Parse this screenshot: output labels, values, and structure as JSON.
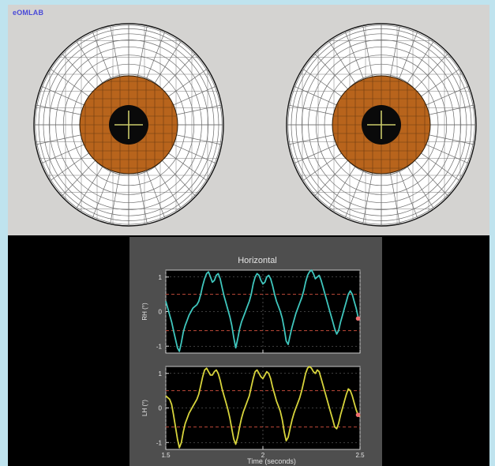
{
  "app": {
    "title": "eOMLAB"
  },
  "eyes": {
    "left": {
      "iris_color": "#b8641c",
      "pupil_color": "#0a0a0a",
      "crosshair_color": "#c9c96a"
    },
    "right": {
      "iris_color": "#b8641c",
      "pupil_color": "#0a0a0a",
      "crosshair_color": "#c9c96a"
    },
    "sclera_color": "#ffffff",
    "grid_color": "#6a6a6a"
  },
  "plot": {
    "title": "Horizontal",
    "xlabel": "Time (seconds)",
    "background": "#4e4e4e",
    "axes_background": "#000000"
  },
  "chart_data": [
    {
      "type": "line",
      "title": "",
      "ylabel": "RH (°)",
      "xlim": [
        1.5,
        2.5
      ],
      "ylim": [
        -1.2,
        1.2
      ],
      "xticks": [
        1.5,
        2.0,
        2.5
      ],
      "xtick_labels": [
        "1.5",
        "2",
        "2.5"
      ],
      "yticks": [
        -1,
        0,
        1
      ],
      "ytick_labels": [
        "-1",
        "0",
        "1"
      ],
      "dashed_reference_y": [
        -0.55,
        0.5
      ],
      "grid": true,
      "series": [
        {
          "color": "#3fc6bd",
          "x": [
            1.5,
            1.51,
            1.52,
            1.53,
            1.54,
            1.55,
            1.56,
            1.57,
            1.58,
            1.59,
            1.6,
            1.61,
            1.62,
            1.63,
            1.64,
            1.65,
            1.66,
            1.67,
            1.68,
            1.69,
            1.7,
            1.71,
            1.72,
            1.73,
            1.74,
            1.75,
            1.76,
            1.77,
            1.78,
            1.79,
            1.8,
            1.81,
            1.82,
            1.83,
            1.84,
            1.85,
            1.86,
            1.87,
            1.88,
            1.89,
            1.9,
            1.91,
            1.92,
            1.93,
            1.94,
            1.95,
            1.96,
            1.97,
            1.98,
            1.99,
            2.0,
            2.01,
            2.02,
            2.03,
            2.04,
            2.05,
            2.06,
            2.07,
            2.08,
            2.09,
            2.1,
            2.11,
            2.12,
            2.13,
            2.14,
            2.15,
            2.16,
            2.17,
            2.18,
            2.19,
            2.2,
            2.21,
            2.22,
            2.23,
            2.24,
            2.25,
            2.26,
            2.27,
            2.28,
            2.29,
            2.3,
            2.31,
            2.32,
            2.33,
            2.34,
            2.35,
            2.36,
            2.37,
            2.38,
            2.39,
            2.4,
            2.41,
            2.42,
            2.43,
            2.44,
            2.45,
            2.46,
            2.47,
            2.48,
            2.49,
            2.5
          ],
          "y": [
            0.3,
            0.1,
            -0.1,
            -0.3,
            -0.55,
            -0.8,
            -1.05,
            -1.15,
            -0.9,
            -0.6,
            -0.4,
            -0.25,
            -0.1,
            0.0,
            0.1,
            0.15,
            0.2,
            0.3,
            0.5,
            0.75,
            0.95,
            1.1,
            1.15,
            1.0,
            0.85,
            0.9,
            1.05,
            1.1,
            0.95,
            0.7,
            0.45,
            0.25,
            0.05,
            -0.15,
            -0.4,
            -0.75,
            -1.05,
            -0.8,
            -0.5,
            -0.3,
            -0.15,
            0.0,
            0.15,
            0.3,
            0.5,
            0.8,
            1.0,
            1.1,
            1.05,
            0.9,
            0.8,
            0.85,
            1.0,
            1.05,
            0.95,
            0.75,
            0.5,
            0.3,
            0.15,
            0.0,
            -0.2,
            -0.5,
            -0.85,
            -0.95,
            -0.7,
            -0.45,
            -0.25,
            -0.05,
            0.1,
            0.25,
            0.4,
            0.6,
            0.85,
            1.05,
            1.15,
            1.2,
            1.1,
            0.95,
            1.0,
            1.05,
            0.9,
            0.7,
            0.5,
            0.3,
            0.1,
            -0.1,
            -0.3,
            -0.5,
            -0.65,
            -0.55,
            -0.3,
            -0.1,
            0.1,
            0.3,
            0.5,
            0.6,
            0.5,
            0.3,
            0.1,
            -0.15,
            -0.2
          ]
        }
      ],
      "markers": [
        {
          "x": 2.49,
          "y": -0.2,
          "color": "#f07070"
        }
      ]
    },
    {
      "type": "line",
      "title": "",
      "ylabel": "LH (°)",
      "xlim": [
        1.5,
        2.5
      ],
      "ylim": [
        -1.2,
        1.2
      ],
      "xticks": [
        1.5,
        2.0,
        2.5
      ],
      "xtick_labels": [
        "1.5",
        "2",
        "2.5"
      ],
      "yticks": [
        -1,
        0,
        1
      ],
      "ytick_labels": [
        "-1",
        "0",
        "1"
      ],
      "dashed_reference_y": [
        -0.55,
        0.5
      ],
      "grid": true,
      "series": [
        {
          "color": "#d7d43c",
          "x": [
            1.5,
            1.51,
            1.52,
            1.53,
            1.54,
            1.55,
            1.56,
            1.57,
            1.58,
            1.59,
            1.6,
            1.61,
            1.62,
            1.63,
            1.64,
            1.65,
            1.66,
            1.67,
            1.68,
            1.69,
            1.7,
            1.71,
            1.72,
            1.73,
            1.74,
            1.75,
            1.76,
            1.77,
            1.78,
            1.79,
            1.8,
            1.81,
            1.82,
            1.83,
            1.84,
            1.85,
            1.86,
            1.87,
            1.88,
            1.89,
            1.9,
            1.91,
            1.92,
            1.93,
            1.94,
            1.95,
            1.96,
            1.97,
            1.98,
            1.99,
            2.0,
            2.01,
            2.02,
            2.03,
            2.04,
            2.05,
            2.06,
            2.07,
            2.08,
            2.09,
            2.1,
            2.11,
            2.12,
            2.13,
            2.14,
            2.15,
            2.16,
            2.17,
            2.18,
            2.19,
            2.2,
            2.21,
            2.22,
            2.23,
            2.24,
            2.25,
            2.26,
            2.27,
            2.28,
            2.29,
            2.3,
            2.31,
            2.32,
            2.33,
            2.34,
            2.35,
            2.36,
            2.37,
            2.38,
            2.39,
            2.4,
            2.41,
            2.42,
            2.43,
            2.44,
            2.45,
            2.46,
            2.47,
            2.48,
            2.49,
            2.5
          ],
          "y": [
            0.35,
            0.3,
            0.25,
            0.1,
            -0.2,
            -0.55,
            -0.9,
            -1.15,
            -1.0,
            -0.7,
            -0.45,
            -0.3,
            -0.15,
            -0.05,
            0.05,
            0.15,
            0.25,
            0.4,
            0.65,
            0.9,
            1.1,
            1.15,
            1.05,
            0.95,
            0.95,
            1.05,
            1.1,
            1.0,
            0.8,
            0.55,
            0.35,
            0.15,
            -0.05,
            -0.3,
            -0.6,
            -0.9,
            -1.05,
            -0.85,
            -0.55,
            -0.3,
            -0.1,
            0.05,
            0.2,
            0.35,
            0.6,
            0.85,
            1.05,
            1.1,
            1.0,
            0.9,
            0.85,
            0.95,
            1.05,
            1.0,
            0.85,
            0.6,
            0.4,
            0.2,
            0.05,
            -0.1,
            -0.35,
            -0.7,
            -0.95,
            -0.85,
            -0.6,
            -0.35,
            -0.15,
            0.0,
            0.15,
            0.3,
            0.5,
            0.75,
            1.0,
            1.15,
            1.2,
            1.15,
            1.05,
            1.0,
            1.1,
            1.05,
            0.85,
            0.65,
            0.45,
            0.25,
            0.05,
            -0.15,
            -0.35,
            -0.55,
            -0.6,
            -0.45,
            -0.2,
            0.0,
            0.2,
            0.4,
            0.55,
            0.5,
            0.35,
            0.15,
            -0.05,
            -0.2,
            -0.25
          ]
        }
      ],
      "markers": [
        {
          "x": 2.49,
          "y": -0.2,
          "color": "#f07070"
        }
      ]
    }
  ]
}
